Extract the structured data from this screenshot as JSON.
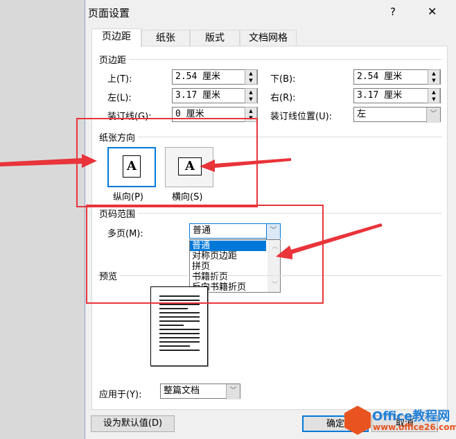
{
  "title": "页面设置",
  "help": "?",
  "close": "✕",
  "tabs": [
    "页边距",
    "纸张",
    "版式",
    "文档网格"
  ],
  "margins": {
    "group": "页边距",
    "top_label": "上(T):",
    "top": "2.54 厘米",
    "bottom_label": "下(B):",
    "bottom": "2.54 厘米",
    "left_label": "左(L):",
    "left": "3.17 厘米",
    "right_label": "右(R):",
    "right": "3.17 厘米",
    "gutter_label": "装订线(G):",
    "gutter": "0 厘米",
    "gutter_pos_label": "装订线位置(U):",
    "gutter_pos": "左"
  },
  "orientation": {
    "group": "纸张方向",
    "portrait": "纵向(P)",
    "landscape": "横向(S)",
    "glyph": "A"
  },
  "pages": {
    "group": "页码范围",
    "multi_label": "多页(M):",
    "value": "普通",
    "options": [
      "普通",
      "对称页边距",
      "拼页",
      "书籍折页",
      "反向书籍折页"
    ]
  },
  "preview": {
    "group": "预览"
  },
  "apply": {
    "label": "应用于(Y):",
    "value": "整篇文档"
  },
  "buttons": {
    "default": "设为默认值(D)",
    "ok": "确定",
    "cancel": "取消"
  },
  "watermark": {
    "brand": "Office教程网",
    "url": "www.office26.com"
  },
  "colors": {
    "annotation": "#e8343a",
    "selection": "#0078d7"
  }
}
